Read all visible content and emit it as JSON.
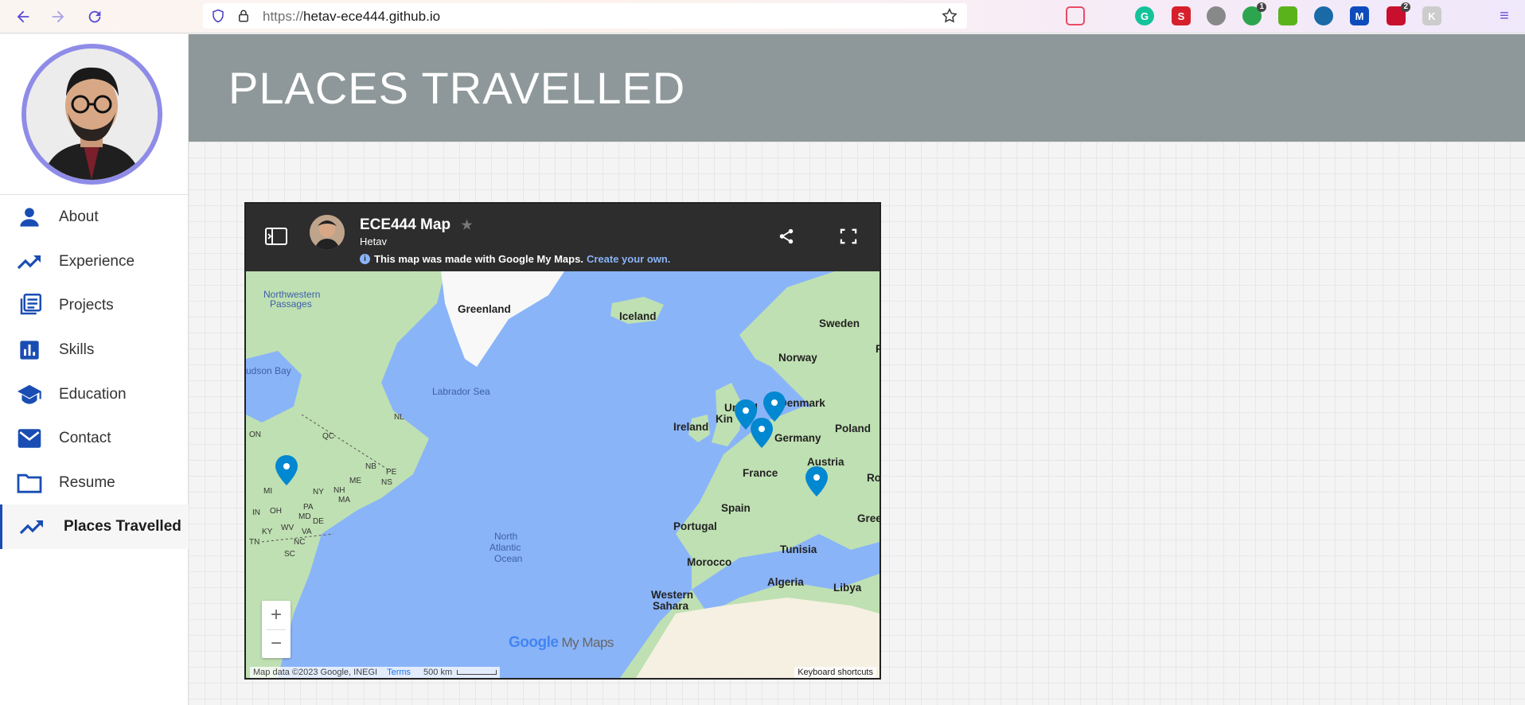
{
  "browser": {
    "url_scheme": "https://",
    "url_host": "hetav-ece444.github.io",
    "extensions": [
      {
        "name": "pocket-icon",
        "color": "#e84b67",
        "text": ""
      },
      {
        "name": "library-icon",
        "color": "#6b4fd1",
        "text": ""
      },
      {
        "name": "grammarly-icon",
        "color": "#15c39a",
        "text": "G"
      },
      {
        "name": "s-extension-icon",
        "color": "#d71f2c",
        "text": "S"
      },
      {
        "name": "gear-extension-icon",
        "color": "#888888",
        "text": ""
      },
      {
        "name": "counter-extension-icon",
        "color": "#2da44e",
        "text": "",
        "badge": "1"
      },
      {
        "name": "download-extension-icon",
        "color": "#5bb31c",
        "text": ""
      },
      {
        "name": "speedometer-extension-icon",
        "color": "#1a6aa8",
        "text": ""
      },
      {
        "name": "malwarebytes-icon",
        "color": "#0d4bbd",
        "text": "M"
      },
      {
        "name": "ublock-icon",
        "color": "#c8102e",
        "text": "",
        "badge": "2"
      },
      {
        "name": "k-extension-icon",
        "color": "#cccccc",
        "text": "K"
      },
      {
        "name": "extensions-puzzle-icon",
        "color": "#6b4fd1",
        "text": ""
      },
      {
        "name": "menu-icon",
        "color": "#6b4fd1",
        "text": "≡"
      }
    ]
  },
  "sidebar": {
    "items": [
      {
        "label": "About",
        "icon": "person-icon"
      },
      {
        "label": "Experience",
        "icon": "trending-up-icon"
      },
      {
        "label": "Projects",
        "icon": "library-books-icon"
      },
      {
        "label": "Skills",
        "icon": "bar-chart-icon"
      },
      {
        "label": "Education",
        "icon": "school-icon"
      },
      {
        "label": "Contact",
        "icon": "mail-icon"
      },
      {
        "label": "Resume",
        "icon": "folder-icon"
      },
      {
        "label": "Places Travelled",
        "icon": "trending-up-icon",
        "active": true
      }
    ]
  },
  "page": {
    "title": "PLACES TRAVELLED"
  },
  "map": {
    "title": "ECE444 Map",
    "author": "Hetav",
    "note": "This map was made with Google My Maps.",
    "note_link": "Create your own.",
    "zoom_in": "+",
    "zoom_out": "−",
    "logo_google": "Google",
    "logo_mymaps": "My Maps",
    "attribution": "Map data ©2023 Google, INEGI",
    "terms": "Terms",
    "scale": "500 km",
    "keyboard": "Keyboard shortcuts",
    "pin_color": "#0288d1",
    "land_color": "#bfe0b2",
    "water_color": "#8ab4f8",
    "labels": [
      {
        "text": "Northwestern",
        "cls": "water"
      },
      {
        "text": "Passages",
        "cls": "water"
      },
      {
        "text": "Greenland",
        "cls": "bold"
      },
      {
        "text": "Iceland",
        "cls": "bold"
      },
      {
        "text": "Sweden",
        "cls": "bold"
      },
      {
        "text": "Norway",
        "cls": "bold"
      },
      {
        "text": "udson Bay",
        "cls": "water"
      },
      {
        "text": "Labrador Sea",
        "cls": "water"
      },
      {
        "text": "United",
        "cls": "bold"
      },
      {
        "text": "Kin",
        "cls": "bold"
      },
      {
        "text": "Denmark",
        "cls": "bold"
      },
      {
        "text": "Ireland",
        "cls": "bold"
      },
      {
        "text": "Germany",
        "cls": "bold"
      },
      {
        "text": "Poland",
        "cls": "bold"
      },
      {
        "text": "France",
        "cls": "bold"
      },
      {
        "text": "Austria",
        "cls": "bold"
      },
      {
        "text": "Rom",
        "cls": "bold"
      },
      {
        "text": "Spain",
        "cls": "bold"
      },
      {
        "text": "Portugal",
        "cls": "bold"
      },
      {
        "text": "Gree",
        "cls": "bold"
      },
      {
        "text": "Morocco",
        "cls": "bold"
      },
      {
        "text": "Tunisia",
        "cls": "bold"
      },
      {
        "text": "Algeria",
        "cls": "bold"
      },
      {
        "text": "Libya",
        "cls": "bold"
      },
      {
        "text": "Western",
        "cls": "bold"
      },
      {
        "text": "Sahara",
        "cls": "bold"
      },
      {
        "text": "North",
        "cls": "water"
      },
      {
        "text": "Atlantic",
        "cls": "water"
      },
      {
        "text": "Ocean",
        "cls": "water"
      },
      {
        "text": "ON",
        "cls": "state"
      },
      {
        "text": "QC",
        "cls": "state"
      },
      {
        "text": "NL",
        "cls": "state"
      },
      {
        "text": "NB",
        "cls": "state"
      },
      {
        "text": "PE",
        "cls": "state"
      },
      {
        "text": "NS",
        "cls": "state"
      },
      {
        "text": "ME",
        "cls": "state"
      },
      {
        "text": "NH",
        "cls": "state"
      },
      {
        "text": "MA",
        "cls": "state"
      },
      {
        "text": "NY",
        "cls": "state"
      },
      {
        "text": "MI",
        "cls": "state"
      },
      {
        "text": "PA",
        "cls": "state"
      },
      {
        "text": "OH",
        "cls": "state"
      },
      {
        "text": "IN",
        "cls": "state"
      },
      {
        "text": "MD",
        "cls": "state"
      },
      {
        "text": "DE",
        "cls": "state"
      },
      {
        "text": "WV",
        "cls": "state"
      },
      {
        "text": "KY",
        "cls": "state"
      },
      {
        "text": "VA",
        "cls": "state"
      },
      {
        "text": "TN",
        "cls": "state"
      },
      {
        "text": "NC",
        "cls": "state"
      },
      {
        "text": "SC",
        "cls": "state"
      },
      {
        "text": "F",
        "cls": "bold"
      }
    ]
  }
}
